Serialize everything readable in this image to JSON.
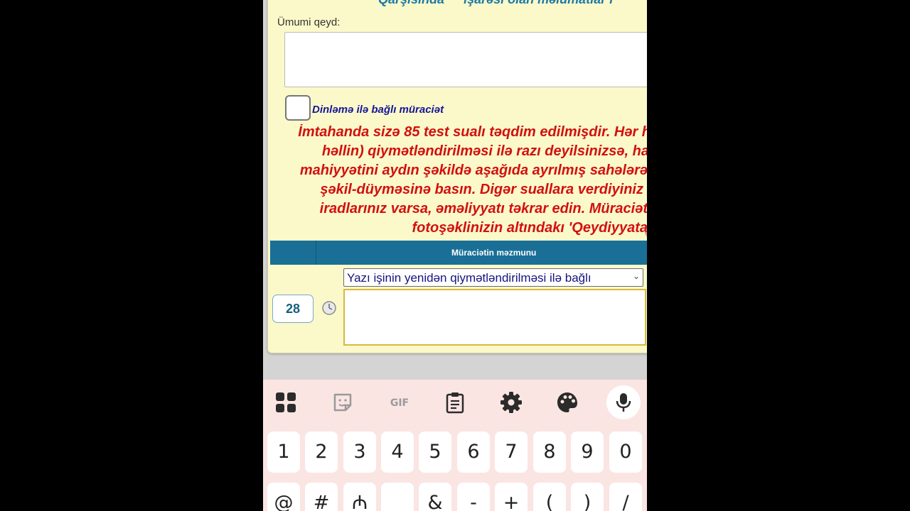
{
  "page": {
    "top_heading_cut": "Qarşısında \"\" işarəsi olan məlumatlar i",
    "general_note_label": "Ümumi qeyd:",
    "listening_checkbox_label": "Dinləmə ilə bağlı müraciət",
    "warning_lines": [
      "İmtahanda sizə 85 test sualı təqdim edilmişdir. Hər h",
      "həllin) qiymətləndirilməsi ilə razı deyilsinizsə, ha",
      "mahiyyətini aydın şəkildə aşağıda ayrılmış sahələrə",
      "şəkil-düyməsinə basın. Digər suallara verdiyiniz",
      "iradlarınız varsa, əməliyyatı təkrar edin. Müraciət",
      "fotoşəklinizin altındakı 'Qeydiyyata"
    ],
    "table_header": "Müraciətin məzmunu",
    "topic_select_value": "Yazı işinin yenidən qiymətləndirilməsi ilə bağlı",
    "question_number": "28"
  },
  "keyboard": {
    "toolbar_icons": [
      "apps-grid-icon",
      "sticker-icon",
      "gif-icon",
      "clipboard-icon",
      "settings-gear-icon",
      "theme-palette-icon",
      "microphone-icon"
    ],
    "gif_label": "GIF",
    "number_row": [
      "1",
      "2",
      "3",
      "4",
      "5",
      "6",
      "7",
      "8",
      "9",
      "0"
    ],
    "symbol_row": [
      "@",
      "#",
      "₼",
      "",
      "&",
      "-",
      "+",
      "(",
      ")",
      "/"
    ]
  },
  "colors": {
    "page_background": "#fbf9c9",
    "warning_text": "#d21010",
    "header_bar": "#1a6f96",
    "heading_text": "#1b79a7",
    "keyboard_background": "#fae5e3"
  }
}
